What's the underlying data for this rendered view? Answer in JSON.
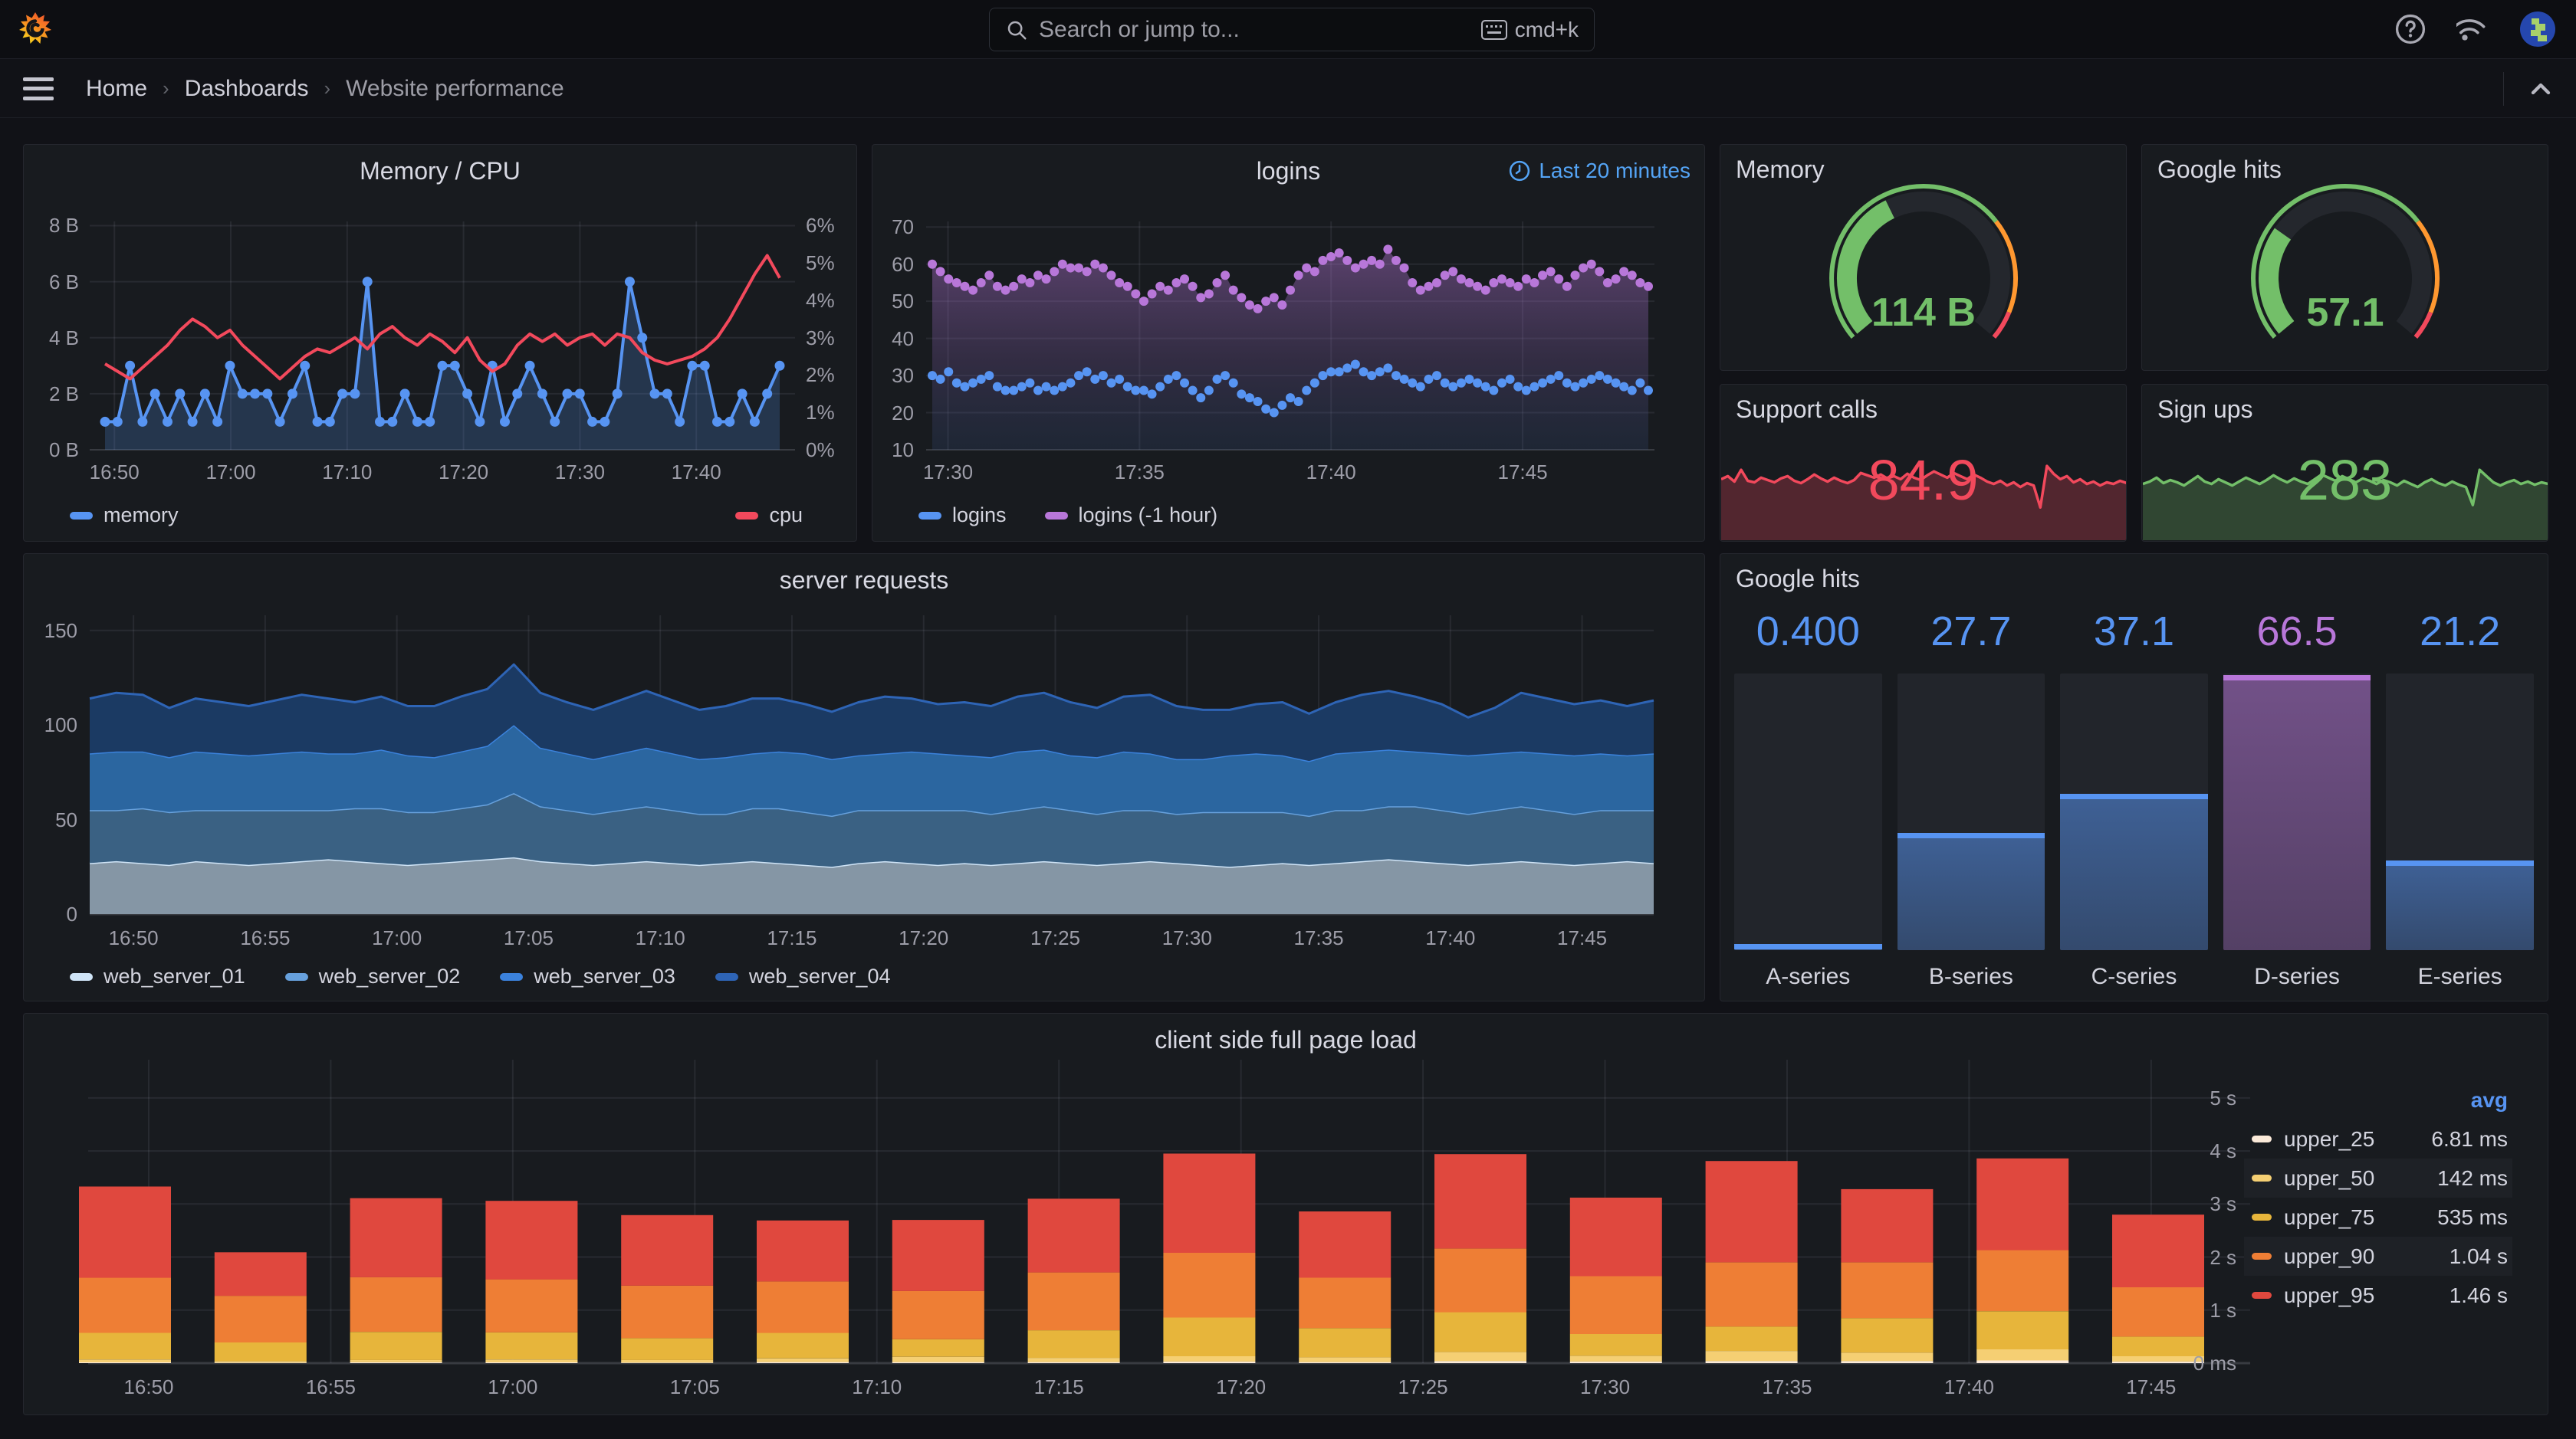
{
  "nav": {
    "search_placeholder": "Search or jump to...",
    "shortcut": "cmd+k"
  },
  "breadcrumb": {
    "home": "Home",
    "dashboards": "Dashboards",
    "current": "Website performance"
  },
  "collapse_icon": "chevron-up",
  "colors": {
    "blue": "#5794F2",
    "red": "#F2495C",
    "green": "#73BF69",
    "purple": "#B877D9",
    "orange": "#FF9830",
    "gold": "#EAB839",
    "link_blue": "#54a4f5"
  },
  "panels": {
    "memory_cpu": {
      "title": "Memory / CPU",
      "y_left_ticks": [
        "8 B",
        "6 B",
        "4 B",
        "2 B",
        "0 B"
      ],
      "y_right_ticks": [
        "6%",
        "5%",
        "4%",
        "3%",
        "2%",
        "1%",
        "0%"
      ],
      "x_ticks": [
        "16:50",
        "17:00",
        "17:10",
        "17:20",
        "17:30",
        "17:40"
      ],
      "legend": [
        {
          "label": "memory",
          "color": "#5794F2"
        },
        {
          "label": "cpu",
          "color": "#F2495C"
        }
      ],
      "memory_b": [
        1,
        1,
        3,
        1,
        2,
        1,
        2,
        1,
        2,
        1,
        3,
        2,
        2,
        2,
        1,
        2,
        3,
        1,
        1,
        2,
        2,
        6,
        1,
        1,
        2,
        1,
        1,
        3,
        3,
        2,
        1,
        3,
        1,
        2,
        3,
        2,
        1,
        2,
        2,
        1,
        1,
        2,
        6,
        4,
        2,
        2,
        1,
        3,
        3,
        1,
        1,
        2,
        1,
        2,
        3
      ],
      "cpu_pct": [
        2.3,
        2.1,
        1.9,
        2.2,
        2.5,
        2.8,
        3.2,
        3.5,
        3.3,
        3.0,
        3.2,
        2.8,
        2.5,
        2.2,
        1.9,
        2.2,
        2.5,
        2.7,
        2.6,
        2.8,
        3.0,
        2.7,
        3.1,
        3.3,
        3.0,
        2.8,
        3.1,
        2.9,
        2.6,
        3.0,
        2.4,
        2.1,
        2.3,
        2.8,
        3.1,
        2.9,
        3.1,
        2.8,
        3.0,
        3.1,
        2.8,
        3.1,
        3.0,
        2.6,
        2.4,
        2.3,
        2.4,
        2.5,
        2.7,
        3.0,
        3.5,
        4.1,
        4.7,
        5.2,
        4.6
      ]
    },
    "logins": {
      "title": "logins",
      "time_range": "Last 20 minutes",
      "y_ticks": [
        "70",
        "60",
        "50",
        "40",
        "30",
        "20",
        "10"
      ],
      "x_ticks": [
        "17:30",
        "17:35",
        "17:40",
        "17:45"
      ],
      "legend": [
        {
          "label": "logins",
          "color": "#5794F2"
        },
        {
          "label": "logins (-1 hour)",
          "color": "#B877D9"
        }
      ],
      "logins_now": [
        30,
        29,
        31,
        28,
        27,
        28,
        29,
        30,
        27,
        26,
        26,
        27,
        28,
        26,
        27,
        26,
        27,
        28,
        30,
        31,
        29,
        30,
        28,
        29,
        27,
        26,
        26,
        25,
        27,
        29,
        30,
        28,
        26,
        24,
        26,
        29,
        30,
        28,
        25,
        24,
        23,
        21,
        20,
        22,
        24,
        23,
        26,
        28,
        30,
        31,
        31,
        32,
        33,
        31,
        30,
        31,
        32,
        30,
        29,
        28,
        27,
        29,
        30,
        28,
        27,
        28,
        29,
        28,
        27,
        26,
        28,
        29,
        27,
        26,
        27,
        28,
        29,
        30,
        28,
        27,
        28,
        29,
        30,
        29,
        28,
        27,
        26,
        28,
        26
      ],
      "logins_prev": [
        60,
        58,
        56,
        55,
        54,
        53,
        55,
        57,
        54,
        53,
        54,
        56,
        55,
        57,
        56,
        58,
        60,
        59,
        59,
        58,
        60,
        59,
        57,
        55,
        54,
        52,
        50,
        52,
        54,
        53,
        55,
        56,
        54,
        51,
        52,
        55,
        57,
        53,
        51,
        49,
        48,
        50,
        51,
        49,
        53,
        57,
        59,
        58,
        61,
        62,
        63,
        61,
        59,
        60,
        61,
        60,
        64,
        61,
        59,
        55,
        53,
        54,
        55,
        57,
        58,
        56,
        55,
        54,
        53,
        55,
        56,
        55,
        54,
        56,
        55,
        57,
        58,
        56,
        54,
        57,
        59,
        60,
        58,
        55,
        56,
        58,
        57,
        55,
        54
      ]
    },
    "memory_gauge": {
      "title": "Memory",
      "value": "114 B",
      "fill": 0.4,
      "color": "#73BF69"
    },
    "google_gauge": {
      "title": "Google hits",
      "value": "57.1",
      "fill": 0.29,
      "color": "#73BF69"
    },
    "support_calls": {
      "title": "Support calls",
      "value": "84.9",
      "color": "#F2495C",
      "spark": [
        78,
        82,
        75,
        90,
        76,
        74,
        80,
        77,
        74,
        79,
        82,
        76,
        73,
        78,
        84,
        79,
        75,
        80,
        76,
        73,
        77,
        86,
        83,
        80,
        84,
        79,
        82,
        78,
        85,
        80,
        77,
        83,
        88,
        84,
        80,
        86,
        82,
        78,
        84,
        80,
        75,
        72,
        76,
        70,
        74,
        68,
        73,
        70,
        42,
        95,
        85,
        78,
        82,
        74,
        78,
        72,
        75,
        70,
        74,
        72,
        76,
        73
      ]
    },
    "sign_ups": {
      "title": "Sign ups",
      "value": "283",
      "color": "#73BF69",
      "spark": [
        72,
        75,
        80,
        73,
        77,
        74,
        70,
        76,
        82,
        75,
        72,
        78,
        74,
        70,
        75,
        80,
        76,
        72,
        77,
        83,
        78,
        74,
        79,
        75,
        72,
        78,
        84,
        80,
        76,
        82,
        78,
        74,
        79,
        76,
        72,
        77,
        74,
        70,
        76,
        72,
        68,
        74,
        78,
        73,
        70,
        75,
        71,
        68,
        45,
        90,
        82,
        74,
        70,
        74,
        77,
        72,
        75,
        71,
        74,
        72
      ]
    },
    "server_requests": {
      "title": "server requests",
      "y_ticks": [
        "150",
        "100",
        "50",
        "0"
      ],
      "x_ticks": [
        "16:50",
        "16:55",
        "17:00",
        "17:05",
        "17:10",
        "17:15",
        "17:20",
        "17:25",
        "17:30",
        "17:35",
        "17:40",
        "17:45"
      ],
      "series": [
        {
          "label": "web_server_01",
          "line": "#CFE4F7",
          "fill": "#8596A5",
          "values": [
            27,
            28,
            27,
            26,
            28,
            27,
            26,
            27,
            28,
            29,
            28,
            27,
            26,
            27,
            28,
            29,
            30,
            28,
            27,
            26,
            27,
            28,
            27,
            26,
            27,
            28,
            27,
            26,
            25,
            27,
            28,
            27,
            26,
            27,
            26,
            27,
            28,
            27,
            26,
            27,
            28,
            27,
            26,
            25,
            26,
            27,
            26,
            27,
            28,
            29,
            28,
            27,
            26,
            27,
            28,
            27,
            26,
            27,
            28,
            27
          ]
        },
        {
          "label": "web_server_02",
          "line": "#67A1DD",
          "fill": "#3A6183",
          "values": [
            28,
            27,
            29,
            28,
            27,
            28,
            29,
            28,
            27,
            26,
            28,
            29,
            28,
            27,
            28,
            29,
            34,
            29,
            28,
            27,
            28,
            29,
            28,
            27,
            26,
            28,
            29,
            28,
            27,
            28,
            27,
            28,
            29,
            28,
            27,
            28,
            29,
            28,
            27,
            28,
            27,
            26,
            28,
            29,
            28,
            27,
            26,
            28,
            27,
            28,
            29,
            28,
            27,
            28,
            29,
            28,
            27,
            28,
            27,
            28
          ]
        },
        {
          "label": "web_server_03",
          "line": "#3B82DC",
          "fill": "#2B66A0",
          "values": [
            30,
            31,
            30,
            29,
            31,
            30,
            29,
            30,
            31,
            30,
            29,
            31,
            30,
            29,
            30,
            31,
            36,
            31,
            30,
            29,
            30,
            31,
            30,
            29,
            30,
            29,
            30,
            31,
            30,
            29,
            30,
            31,
            30,
            29,
            30,
            31,
            30,
            29,
            30,
            31,
            30,
            29,
            28,
            30,
            31,
            30,
            29,
            30,
            31,
            30,
            29,
            30,
            31,
            30,
            29,
            30,
            31,
            30,
            29,
            30
          ]
        },
        {
          "label": "web_server_04",
          "line": "#2E64B5",
          "fill": "#1B3A63",
          "values": [
            29,
            31,
            30,
            26,
            28,
            27,
            26,
            28,
            30,
            29,
            27,
            28,
            26,
            27,
            29,
            30,
            32,
            29,
            27,
            26,
            28,
            30,
            28,
            26,
            27,
            29,
            28,
            26,
            25,
            28,
            30,
            28,
            26,
            28,
            27,
            29,
            30,
            28,
            26,
            29,
            31,
            28,
            26,
            24,
            26,
            28,
            25,
            27,
            30,
            31,
            29,
            26,
            20,
            24,
            31,
            29,
            27,
            28,
            26,
            28
          ]
        }
      ]
    },
    "google_hits_bars": {
      "title": "Google hits",
      "bars": [
        {
          "label": "A-series",
          "value": "0.400",
          "pct": 0.008,
          "color": "#5794F2"
        },
        {
          "label": "B-series",
          "value": "27.7",
          "pct": 0.41,
          "color": "#5794F2"
        },
        {
          "label": "C-series",
          "value": "37.1",
          "pct": 0.55,
          "color": "#5794F2"
        },
        {
          "label": "D-series",
          "value": "66.5",
          "pct": 0.98,
          "color": "#B877D9"
        },
        {
          "label": "E-series",
          "value": "21.2",
          "pct": 0.31,
          "color": "#5794F2"
        }
      ]
    },
    "page_load": {
      "title": "client side full page load",
      "y_ticks": [
        "5 s",
        "4 s",
        "3 s",
        "2 s",
        "1 s",
        "0 ms"
      ],
      "x_ticks": [
        "16:50",
        "16:55",
        "17:00",
        "17:05",
        "17:10",
        "17:15",
        "17:20",
        "17:25",
        "17:30",
        "17:35",
        "17:40",
        "17:45"
      ],
      "legend_header": "avg",
      "series": [
        {
          "label": "upper_25",
          "color": "#FBEAD9",
          "avg": "6.81 ms"
        },
        {
          "label": "upper_50",
          "color": "#F5CF73",
          "avg": "142 ms"
        },
        {
          "label": "upper_75",
          "color": "#E7B53B",
          "avg": "535 ms"
        },
        {
          "label": "upper_90",
          "color": "#EE7E35",
          "avg": "1.04 s"
        },
        {
          "label": "upper_95",
          "color": "#E0483E",
          "avg": "1.46 s"
        }
      ],
      "bars": [
        [
          0.015,
          0.055,
          0.5,
          1.04,
          1.72
        ],
        [
          0.01,
          0.03,
          0.35,
          0.88,
          0.82
        ],
        [
          0.015,
          0.045,
          0.53,
          1.03,
          1.49
        ],
        [
          0.015,
          0.055,
          0.51,
          1.0,
          1.48
        ],
        [
          0.01,
          0.05,
          0.41,
          0.99,
          1.33
        ],
        [
          0.02,
          0.07,
          0.48,
          0.97,
          1.15
        ],
        [
          0.02,
          0.1,
          0.33,
          0.91,
          1.34
        ],
        [
          0.02,
          0.08,
          0.52,
          1.09,
          1.39
        ],
        [
          0.03,
          0.1,
          0.73,
          1.22,
          1.87
        ],
        [
          0.02,
          0.09,
          0.55,
          0.95,
          1.25
        ],
        [
          0.04,
          0.17,
          0.75,
          1.2,
          1.78
        ],
        [
          0.03,
          0.11,
          0.41,
          1.09,
          1.48
        ],
        [
          0.04,
          0.19,
          0.46,
          1.21,
          1.91
        ],
        [
          0.04,
          0.16,
          0.65,
          1.05,
          1.38
        ],
        [
          0.05,
          0.21,
          0.72,
          1.15,
          1.73
        ],
        [
          0.03,
          0.1,
          0.37,
          0.93,
          1.37
        ]
      ]
    }
  }
}
